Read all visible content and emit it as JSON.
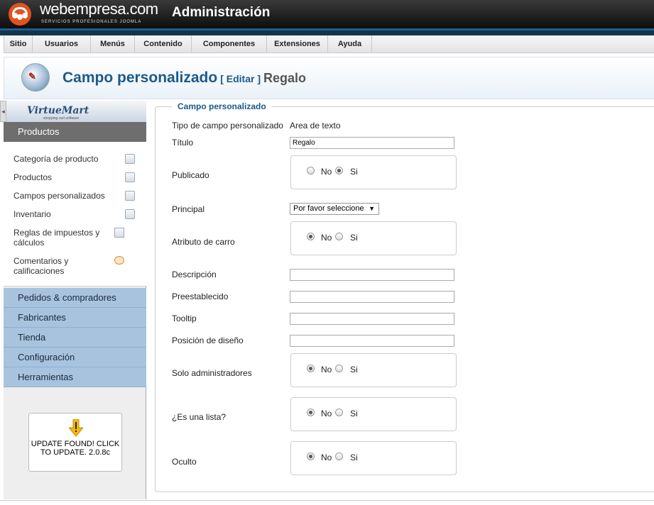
{
  "header": {
    "brand_name": "webempresa.com",
    "brand_tagline": "SERVICIOS PROFESIONALES JOOMLA",
    "admin_title": "Administración"
  },
  "menu": [
    "Sitio",
    "Usuarios",
    "Menús",
    "Contenido",
    "Componentes",
    "Extensiones",
    "Ayuda"
  ],
  "title": {
    "main": "Campo personalizado",
    "edit": "[ Editar ]",
    "record": "Regalo"
  },
  "sidebar": {
    "logo_text": "VirtueMart",
    "logo_tagline": "shopping cart software",
    "active_section": "Productos",
    "items": [
      "Categoría de producto",
      "Productos",
      "Campos personalizados",
      "Inventario",
      "Reglas de impuestos y cálculos",
      "Comentarios y calificaciones"
    ],
    "sections": [
      "Pedidos & compradores",
      "Fabricantes",
      "Tienda",
      "Configuración",
      "Herramientas"
    ],
    "update_notice": "UPDATE FOUND! CLICK TO UPDATE. 2.0.8c"
  },
  "form": {
    "legend": "Campo personalizado",
    "type_label": "Tipo de campo personalizado",
    "type_value": "Area de texto",
    "title_label": "Título",
    "title_value": "Regalo",
    "published_label": "Publicado",
    "principal_label": "Principal",
    "principal_select": "Por favor seleccione",
    "cart_attr_label": "Atributo de carro",
    "description_label": "Descripción",
    "default_label": "Preestablecido",
    "tooltip_label": "Tooltip",
    "layout_pos_label": "Posición de diseño",
    "admin_only_label": "Solo administradores",
    "is_list_label": "¿Es una lista?",
    "hidden_label": "Oculto",
    "no": "No",
    "si": "Si"
  }
}
